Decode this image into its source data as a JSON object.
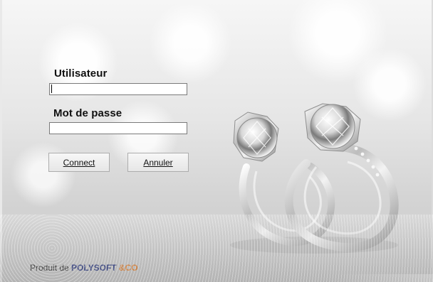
{
  "login": {
    "user_label": "Utilisateur",
    "user_value": "",
    "password_label": "Mot de passe",
    "password_value": "",
    "connect_button": "Connect",
    "cancel_button": "Annuler"
  },
  "footer": {
    "prefix": "Produit de ",
    "brand": "POLYSOFT",
    "company": "&CO"
  },
  "image": {
    "subject": "diamond-rings"
  },
  "colors": {
    "brand": "#1f2e7a",
    "company": "#e4761b"
  }
}
